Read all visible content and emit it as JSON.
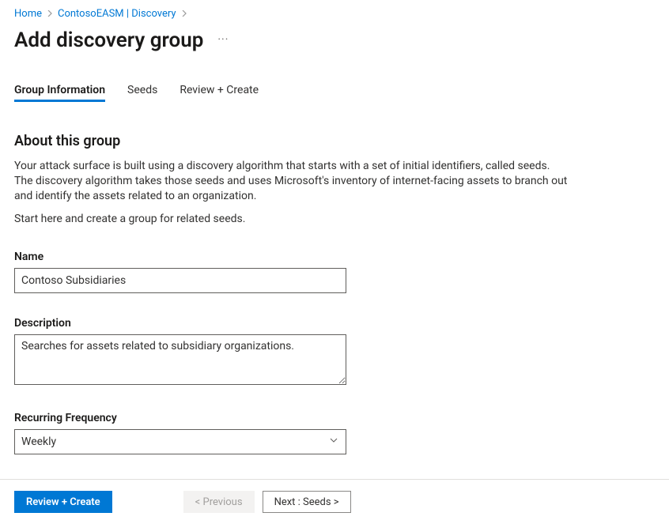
{
  "breadcrumb": {
    "home": "Home",
    "workspace": "ContosoEASM | Discovery"
  },
  "title": "Add discovery group",
  "ellipsis": "···",
  "tabs": {
    "group_info": "Group Information",
    "seeds": "Seeds",
    "review": "Review + Create"
  },
  "section": {
    "heading": "About this group",
    "p1": "Your attack surface is built using a discovery algorithm that starts with a set of initial identifiers, called seeds. The discovery algorithm takes those seeds and uses Microsoft's inventory of internet-facing assets to branch out and identify the assets related to an organization.",
    "p2": "Start here and create a group for related seeds."
  },
  "form": {
    "name_label": "Name",
    "name_value": "Contoso Subsidiaries",
    "desc_label": "Description",
    "desc_value": "Searches for assets related to subsidiary organizations.",
    "freq_label": "Recurring Frequency",
    "freq_value": "Weekly"
  },
  "footer": {
    "review": "Review + Create",
    "previous": "< Previous",
    "next": "Next : Seeds >"
  }
}
